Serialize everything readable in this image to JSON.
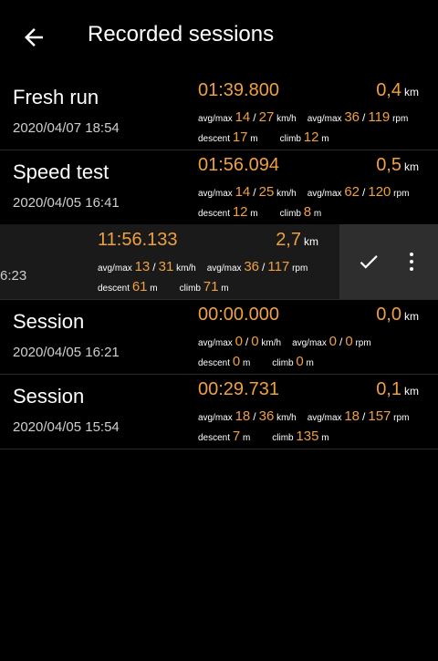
{
  "appbar": {
    "title": "Recorded sessions",
    "back_icon": "arrow-back-icon"
  },
  "sessions": [
    {
      "name": "Fresh run",
      "date": "2020/04/07 18:54",
      "time": "01:39.800",
      "distance": "0,4",
      "distance_unit": "km",
      "speed_label": "avg/max",
      "speed_avg": "14",
      "speed_max": "27",
      "speed_unit": "km/h",
      "cad_label": "avg/max",
      "cad_avg": "36",
      "cad_max": "119",
      "cad_unit": "rpm",
      "descent_label": "descent",
      "descent": "17",
      "descent_unit": "m",
      "climb_label": "climb",
      "climb": "12",
      "climb_unit": "m"
    },
    {
      "name": "Speed test",
      "date": "2020/04/05 16:41",
      "time": "01:56.094",
      "distance": "0,5",
      "distance_unit": "km",
      "speed_label": "avg/max",
      "speed_avg": "14",
      "speed_max": "25",
      "speed_unit": "km/h",
      "cad_label": "avg/max",
      "cad_avg": "62",
      "cad_max": "120",
      "cad_unit": "rpm",
      "descent_label": "descent",
      "descent": "12",
      "descent_unit": "m",
      "climb_label": "climb",
      "climb": "8",
      "climb_unit": "m"
    },
    {
      "date_fragment": "6:23",
      "time": "11:56.133",
      "distance": "2,7",
      "distance_unit": "km",
      "speed_label": "avg/max",
      "speed_avg": "13",
      "speed_max": "31",
      "speed_unit": "km/h",
      "cad_label": "avg/max",
      "cad_avg": "36",
      "cad_max": "117",
      "cad_unit": "rpm",
      "descent_label": "descent",
      "descent": "61",
      "descent_unit": "m",
      "climb_label": "climb",
      "climb": "71",
      "climb_unit": "m",
      "actions": [
        "check-icon",
        "more-vert-icon"
      ]
    },
    {
      "name": "Session",
      "date": "2020/04/05 16:21",
      "time": "00:00.000",
      "distance": "0,0",
      "distance_unit": "km",
      "speed_label": "avg/max",
      "speed_avg": "0",
      "speed_max": "0",
      "speed_unit": "km/h",
      "cad_label": "avg/max",
      "cad_avg": "0",
      "cad_max": "0",
      "cad_unit": "rpm",
      "descent_label": "descent",
      "descent": "0",
      "descent_unit": "m",
      "climb_label": "climb",
      "climb": "0",
      "climb_unit": "m"
    },
    {
      "name": "Session",
      "date": "2020/04/05 15:54",
      "time": "00:29.731",
      "distance": "0,1",
      "distance_unit": "km",
      "speed_label": "avg/max",
      "speed_avg": "18",
      "speed_max": "36",
      "speed_unit": "km/h",
      "cad_label": "avg/max",
      "cad_avg": "18",
      "cad_max": "157",
      "cad_unit": "rpm",
      "descent_label": "descent",
      "descent": "7",
      "descent_unit": "m",
      "climb_label": "climb",
      "climb": "135",
      "climb_unit": "m"
    }
  ],
  "colors": {
    "accent": "#f0a040",
    "background": "#000000",
    "swipe_bg": "#2e2e2e"
  }
}
